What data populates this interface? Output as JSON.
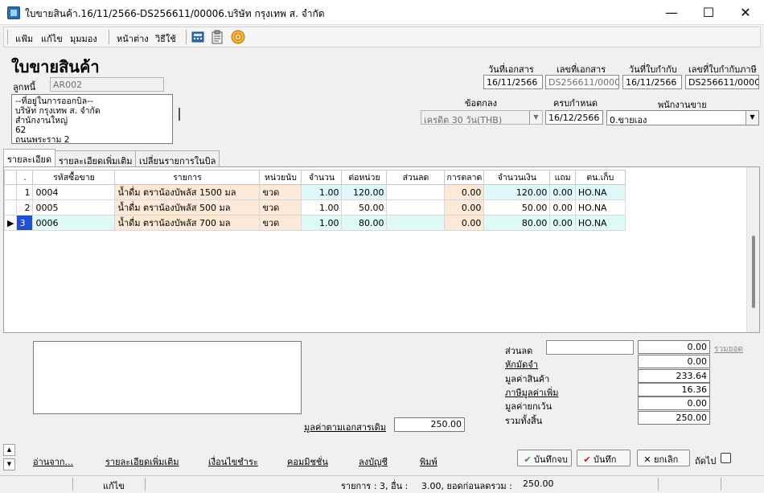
{
  "window": {
    "title": "ใบขายสินค้า.16/11/2566-DS256611/00006.บริษัท กรุงเทพ ส. จำกัด",
    "minimize": "—",
    "maximize": "☐",
    "close": "✕"
  },
  "menu": {
    "file": "แฟ้ม",
    "edit": "แก้ไข",
    "view": "มุมมอง",
    "window": "หน้าต่าง",
    "help": "วิธีใช้"
  },
  "header": {
    "page_title": "ใบขายสินค้า",
    "debtor_label": "ลูกหนี้",
    "debtor_code": "AR002",
    "address_lines": [
      "--ที่อยู่ในการออกบิล--",
      "บริษัท กรุงเทพ ส. จำกัด",
      "สำนักงานใหญ่",
      "62",
      "ถนนพระราม 2"
    ],
    "doc_date_label": "วันที่เอกสาร",
    "doc_date": "16/11/2566",
    "doc_no_label": "เลขที่เอกสาร",
    "doc_no": "DS256611/00006",
    "invoice_date_label": "วันที่ใบกำกับ",
    "invoice_date": "16/11/2566",
    "tax_invoice_no_label": "เลขที่ใบกำกับภาษี",
    "tax_invoice_no": "DS256611/00006",
    "terms_label": "ข้อตกลง",
    "terms_value": "เครดิต 30 วัน(THB)",
    "due_label": "ครบกำหนด",
    "due_date": "16/12/2566",
    "salesperson_label": "พนักงานขาย",
    "salesperson_value": "0.ขายเอง"
  },
  "tabs": [
    "รายละเอียด",
    "รายละเอียดเพิ่มเติม",
    "เปลี่ยนรายการในบิล"
  ],
  "grid": {
    "columns": [
      ".",
      "รหัสซื้อขาย",
      "รายการ",
      "หน่วยนับ",
      "จำนวน",
      "ต่อหน่วย",
      "ส่วนลด",
      "การตลาด",
      "จำนวนเงิน",
      "แถม",
      "ตน.เก็บ"
    ],
    "rows": [
      {
        "no": "1",
        "code": "0004",
        "desc": "น้ำดื่ม ตราน้องบัพลัส 1500 มล",
        "unit": "ขวด",
        "qty": "1.00",
        "price": "120.00",
        "discount": "",
        "marketing": "0.00",
        "amount": "120.00",
        "free": "0.00",
        "store": "HO.NA"
      },
      {
        "no": "2",
        "code": "0005",
        "desc": "น้ำดื่ม ตราน้องบัพลัส 500 มล",
        "unit": "ขวด",
        "qty": "1.00",
        "price": "50.00",
        "discount": "",
        "marketing": "0.00",
        "amount": "50.00",
        "free": "0.00",
        "store": "HO.NA"
      },
      {
        "no": "3",
        "code": "0006",
        "desc": "น้ำดื่ม ตราน้องบัพลัส 700 มล",
        "unit": "ขวด",
        "qty": "1.00",
        "price": "80.00",
        "discount": "",
        "marketing": "0.00",
        "amount": "80.00",
        "free": "0.00",
        "store": "HO.NA"
      }
    ]
  },
  "summary": {
    "discount_label": "ส่วนลด",
    "discount_input": "",
    "discount_value": "0.00",
    "total_link": "รวมยอด",
    "deposit_label": "หักมัดจำ",
    "deposit_value": "0.00",
    "goods_value_label": "มูลค่าสินค้า",
    "goods_value": "233.64",
    "vat_label": "ภาษีมูลค่าเพิ่ม",
    "vat_value": "16.36",
    "exempt_label": "มูลค่ายกเว้น",
    "exempt_value": "0.00",
    "grand_total_label": "รวมทั้งสิ้น",
    "grand_total": "250.00",
    "orig_doc_value_label": "มูลค่าตามเอกสารเดิม",
    "orig_doc_value": "250.00"
  },
  "links": [
    "อ่านจาก...",
    "รายละเอียดเพิ่มเติม",
    "เงื่อนไขชำระ",
    "คอมมิชชั่น",
    "ลงบัญชี",
    "พิมพ์"
  ],
  "buttons": {
    "save_close": "บันทึกจบ",
    "save": "บันทึก",
    "cancel": "ยกเลิก",
    "next": "ถัดไป"
  },
  "status": {
    "mode": "แก้ไข",
    "items_text": "รายการ : 3, อื่น :",
    "balance_text": "3.00, ยอดก่อนลดรวม :",
    "total": "250.00"
  },
  "colors": {
    "selected": "#1e50d0",
    "qty_column": "#dff8f8",
    "text_column": "#fde9d7",
    "check_icon": "#2a9a2a",
    "save_icon": "#d01010"
  }
}
